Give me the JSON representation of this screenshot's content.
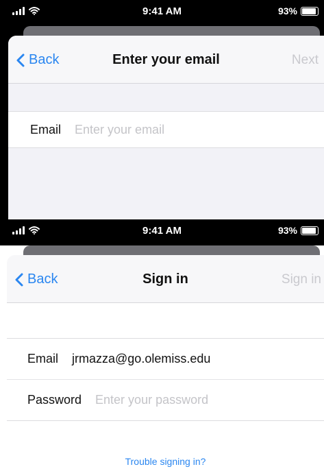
{
  "screen_1": {
    "status_bar": {
      "time": "9:41 AM",
      "battery": "93%",
      "battery_level": 0.93
    },
    "nav": {
      "back_label": "Back",
      "title": "Enter your email",
      "right_label": "Next"
    },
    "form": {
      "email_label": "Email",
      "email_placeholder": "Enter your email"
    }
  },
  "screen_2": {
    "status_bar": {
      "time": "9:41 AM",
      "battery": "93%",
      "battery_level": 0.93
    },
    "nav": {
      "back_label": "Back",
      "title": "Sign in",
      "right_label": "Sign in"
    },
    "form": {
      "email_label": "Email",
      "email_value": "jrmazza@go.olemiss.edu",
      "password_label": "Password",
      "password_placeholder": "Enter your password"
    },
    "trouble_link": "Trouble signing in?"
  },
  "colors": {
    "accent": "#2a86f0",
    "disabled": "#c9c9ce",
    "background": "#f2f2f7"
  }
}
